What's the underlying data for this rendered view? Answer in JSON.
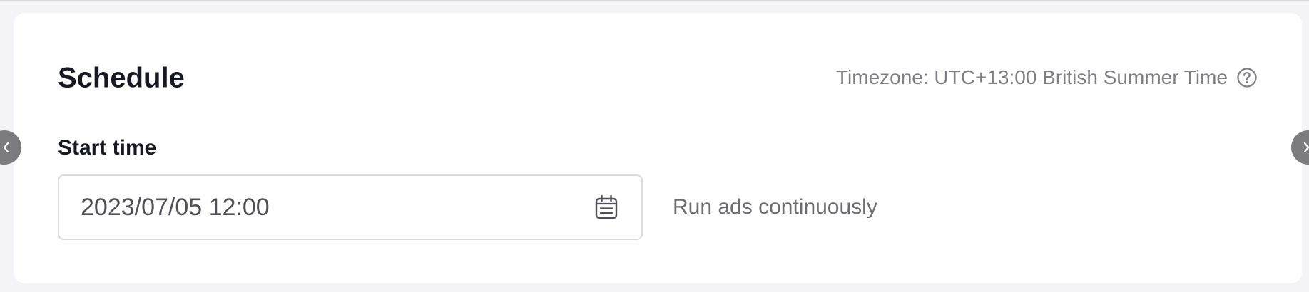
{
  "schedule": {
    "title": "Schedule",
    "timezone_text": "Timezone: UTC+13:00 British Summer Time",
    "timezone_help_icon": "question-circle-icon",
    "start_time": {
      "label": "Start time",
      "value": "2023/07/05 12:00",
      "icon": "calendar-icon"
    },
    "run_option_text": "Run ads continuously"
  },
  "navigation": {
    "prev_icon": "chevron-left-icon",
    "next_icon": "chevron-right-icon"
  },
  "colors": {
    "page_background": "#f4f4f8",
    "card_background": "#ffffff",
    "title_text": "#161823",
    "muted_text": "#7e7f86",
    "input_border": "#dcdce0",
    "nav_button": "#7c7c80"
  }
}
